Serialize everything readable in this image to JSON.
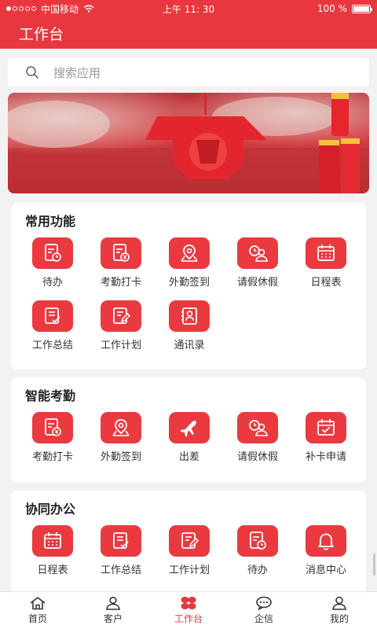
{
  "status_bar": {
    "carrier": "中国移动",
    "time": "上午 11: 30",
    "battery": "100 %"
  },
  "header": {
    "title": "工作台"
  },
  "search": {
    "placeholder": "搜索应用"
  },
  "sections": [
    {
      "title": "常用功能",
      "items": [
        {
          "label": "待办",
          "icon": "clock-doc-icon"
        },
        {
          "label": "考勤打卡",
          "icon": "yen-doc-icon"
        },
        {
          "label": "外勤签到",
          "icon": "map-pin-icon"
        },
        {
          "label": "请假休假",
          "icon": "leave-icon"
        },
        {
          "label": "日程表",
          "icon": "calendar-icon"
        },
        {
          "label": "工作总结",
          "icon": "check-doc-icon"
        },
        {
          "label": "工作计划",
          "icon": "edit-doc-icon"
        },
        {
          "label": "通讯录",
          "icon": "contacts-icon"
        }
      ]
    },
    {
      "title": "智能考勤",
      "items": [
        {
          "label": "考勤打卡",
          "icon": "yen-doc-icon"
        },
        {
          "label": "外勤签到",
          "icon": "map-pin-icon"
        },
        {
          "label": "出差",
          "icon": "airplane-icon"
        },
        {
          "label": "请假休假",
          "icon": "leave-icon"
        },
        {
          "label": "补卡申请",
          "icon": "calendar-check-icon"
        }
      ]
    },
    {
      "title": "协同办公",
      "items": [
        {
          "label": "日程表",
          "icon": "calendar-icon"
        },
        {
          "label": "工作总结",
          "icon": "check-doc-icon"
        },
        {
          "label": "工作计划",
          "icon": "edit-doc-icon"
        },
        {
          "label": "待办",
          "icon": "clock-doc-icon"
        },
        {
          "label": "消息中心",
          "icon": "bell-icon"
        }
      ]
    }
  ],
  "tabbar": [
    {
      "label": "首页",
      "icon": "home-icon"
    },
    {
      "label": "客户",
      "icon": "customer-icon"
    },
    {
      "label": "工作台",
      "icon": "workbench-icon",
      "active": true
    },
    {
      "label": "企信",
      "icon": "chat-icon"
    },
    {
      "label": "我的",
      "icon": "profile-icon"
    }
  ],
  "colors": {
    "primary": "#e8373e",
    "icon_tile": "#ea3a40",
    "background": "#f2f2f2"
  }
}
